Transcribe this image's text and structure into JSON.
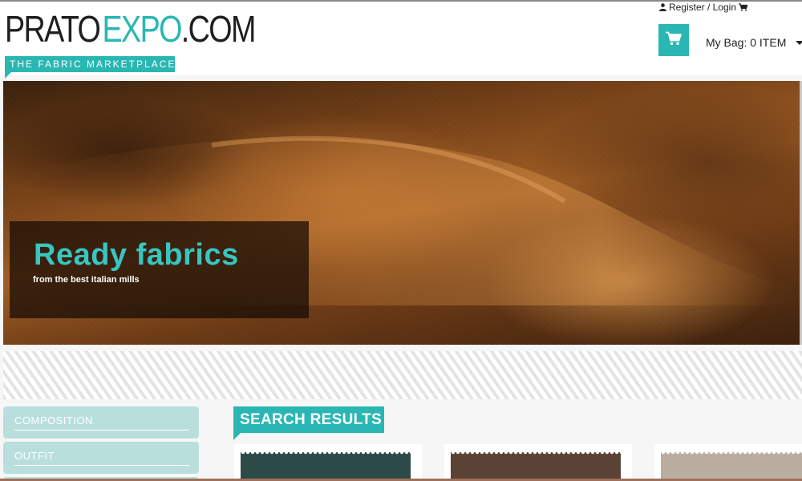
{
  "header": {
    "logo": {
      "word1": "PRATO",
      "word2": "EXPO",
      "word3": ".COM",
      "tagline": "THE FABRIC MARKETPLACE"
    },
    "user_links": {
      "label": "Register / Login",
      "user_icon": "user-icon",
      "cart_icon": "cart-icon"
    },
    "bag": {
      "label": "My Bag: 0 ITEM",
      "cart_icon": "shopping-cart-icon",
      "dropdown_icon": "caret-down-icon"
    }
  },
  "hero": {
    "title": "Ready fabrics",
    "subtitle": "from the best italian mills"
  },
  "sidebar": {
    "items": [
      {
        "label": "COMPOSITION"
      },
      {
        "label": "OUTFIT"
      }
    ]
  },
  "results": {
    "title": "SEARCH RESULTS",
    "cards": [
      {
        "swatch_color": "#2c4a47"
      },
      {
        "swatch_color": "#5a4234"
      },
      {
        "swatch_color": "#b8ad9f"
      }
    ]
  },
  "colors": {
    "accent": "#2ab7b3",
    "sidebar_bg": "#b9dfdd",
    "text": "#222222"
  }
}
